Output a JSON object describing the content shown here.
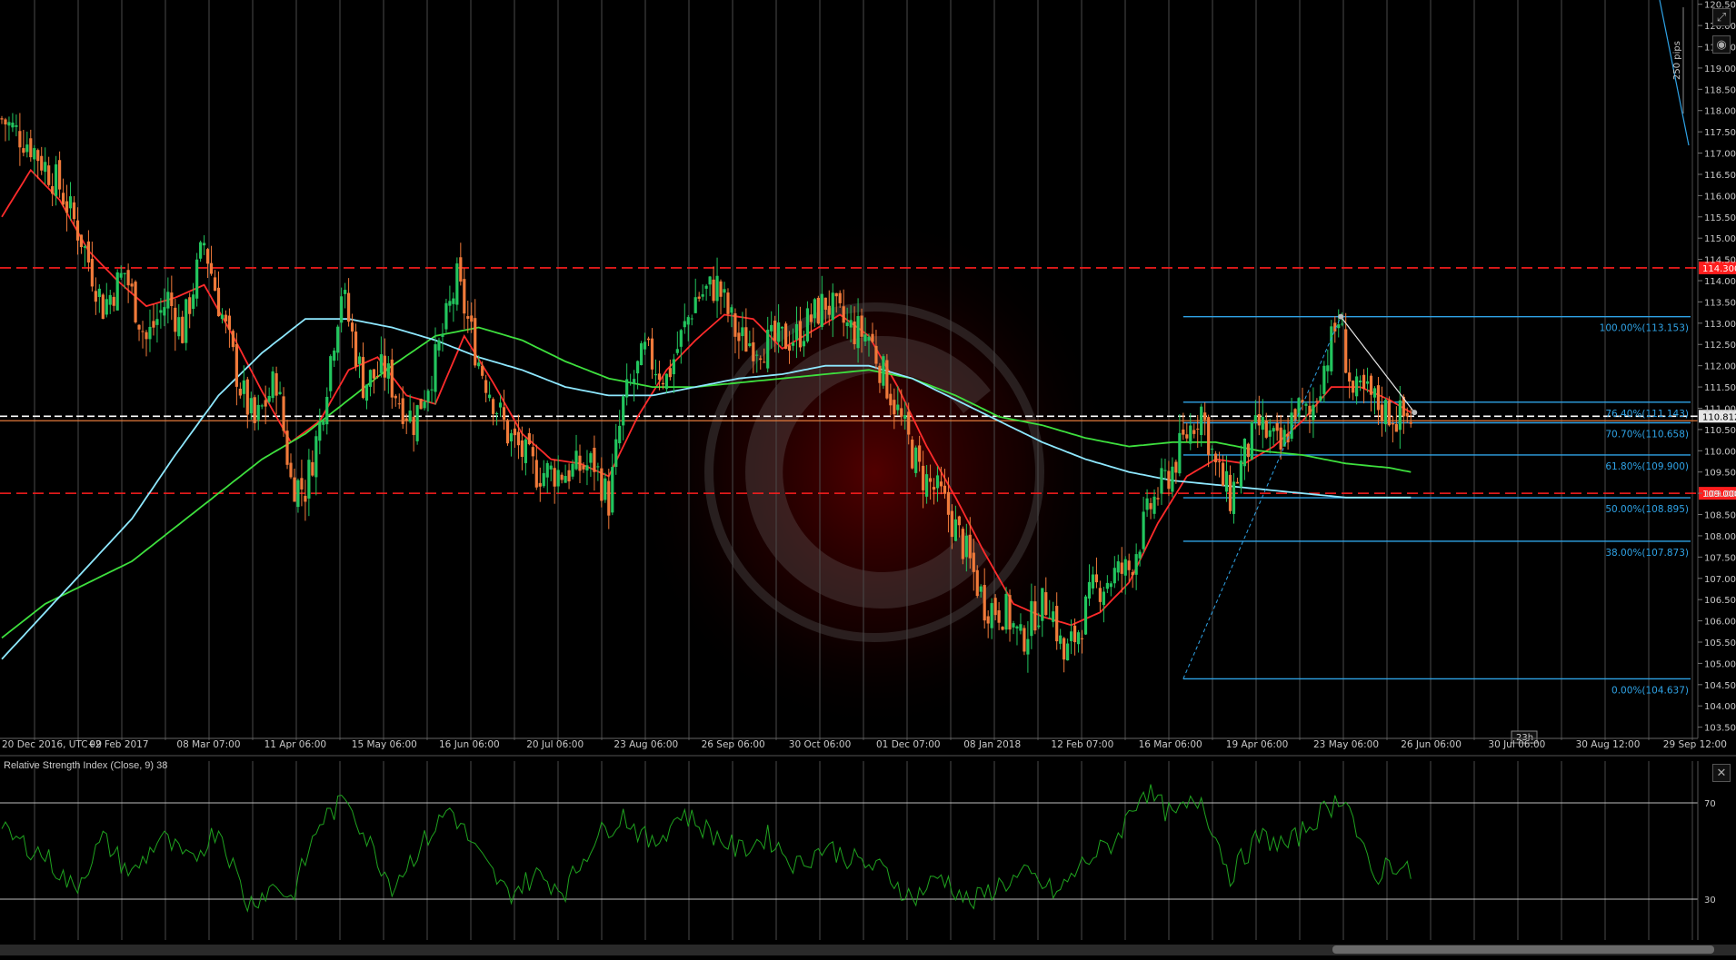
{
  "colors": {
    "background": "#000000",
    "grid": "#4a4a4a",
    "bull": "#22c55e",
    "bear": "#f07a3a",
    "ema_fast": "#ff2b2b",
    "ema_mid": "#3ee03e",
    "ema_slow": "#8ee8ff",
    "fib": "#2fa3e6",
    "resistance": "#ff1e1e",
    "rsi_line": "#1fa31f",
    "price_tag_bg": "#e6e6e6"
  },
  "icons": {
    "top_right_1": "maximize-icon",
    "top_right_2": "camera-icon",
    "rsi_close": "close-icon",
    "timer": "timer-badge"
  },
  "rsi": {
    "title": "Relative Strength Index (Close, 9) 38",
    "levels": [
      "70",
      "30"
    ]
  },
  "timer_label": "23h",
  "current_price_label": "110.812",
  "chart_data": {
    "type": "candlestick",
    "x_tick_labels": [
      "20 Dec 2016, UTC+9",
      "02 Feb 2017",
      "08 Mar 07:00",
      "11 Apr 06:00",
      "15 May 06:00",
      "16 Jun 06:00",
      "20 Jul 06:00",
      "23 Aug 06:00",
      "26 Sep 06:00",
      "30 Oct 06:00",
      "01 Dec 07:00",
      "08 Jan 2018",
      "12 Feb 07:00",
      "16 Mar 06:00",
      "19 Apr 06:00",
      "23 May 06:00",
      "26 Jun 06:00",
      "30 Jul 06:00",
      "30 Aug 12:00",
      "29 Sep 12:00"
    ],
    "y_ticks": [
      "103.500",
      "104.000",
      "104.500",
      "105.000",
      "105.500",
      "106.000",
      "106.500",
      "107.000",
      "107.500",
      "108.000",
      "108.500",
      "109.000",
      "109.500",
      "110.000",
      "110.500",
      "111.000",
      "111.500",
      "112.000",
      "112.500",
      "113.000",
      "113.500",
      "114.000",
      "114.500",
      "115.000",
      "115.500",
      "116.000",
      "116.500",
      "117.000",
      "117.500",
      "118.000",
      "118.500",
      "119.000",
      "119.500",
      "120.000",
      "120.500"
    ],
    "ylim": [
      103.3,
      120.6
    ],
    "grid": true,
    "horizontal_levels": [
      {
        "label": "114.300",
        "value": 114.3,
        "style": "dashed"
      },
      {
        "label": "109.000",
        "value": 109.0,
        "style": "dashed"
      }
    ],
    "current_price": 110.812,
    "fibonacci": [
      {
        "label": "100.00%(113.153)",
        "value": 113.153
      },
      {
        "label": "76.40%(111.143)",
        "value": 111.143
      },
      {
        "label": "70.70%(110.658)",
        "value": 110.658
      },
      {
        "label": "61.80%(109.900)",
        "value": 109.9
      },
      {
        "label": "50.00%(108.895)",
        "value": 108.895
      },
      {
        "label": "38.00%(107.873)",
        "value": 107.873
      },
      {
        "label": "0.00%(104.637)",
        "value": 104.637
      }
    ],
    "trend_annotation": "250 pips",
    "close_path": [
      [
        0,
        117.8
      ],
      [
        4,
        117.2
      ],
      [
        8,
        116.2
      ],
      [
        11,
        115.0
      ],
      [
        14,
        113.4
      ],
      [
        17,
        114.2
      ],
      [
        20,
        112.6
      ],
      [
        23,
        113.6
      ],
      [
        25,
        112.8
      ],
      [
        28,
        114.9
      ],
      [
        30,
        113.5
      ],
      [
        33,
        111.5
      ],
      [
        35,
        110.6
      ],
      [
        38,
        111.7
      ],
      [
        40,
        109.3
      ],
      [
        42,
        109.1
      ],
      [
        44,
        110.6
      ],
      [
        47,
        113.8
      ],
      [
        50,
        111.6
      ],
      [
        53,
        111.9
      ],
      [
        55,
        111.2
      ],
      [
        57,
        110.7
      ],
      [
        60,
        112.1
      ],
      [
        63,
        114.0
      ],
      [
        66,
        112.1
      ],
      [
        70,
        110.4
      ],
      [
        74,
        109.5
      ],
      [
        78,
        109.5
      ],
      [
        82,
        109.7
      ],
      [
        84,
        108.8
      ],
      [
        86,
        111.1
      ],
      [
        89,
        112.3
      ],
      [
        92,
        111.7
      ],
      [
        96,
        113.6
      ],
      [
        99,
        113.9
      ],
      [
        102,
        112.6
      ],
      [
        106,
        112.5
      ],
      [
        110,
        112.7
      ],
      [
        114,
        113.5
      ],
      [
        117,
        112.9
      ],
      [
        120,
        112.7
      ],
      [
        124,
        110.9
      ],
      [
        127,
        109.5
      ],
      [
        130,
        108.9
      ],
      [
        133,
        107.8
      ],
      [
        136,
        106.4
      ],
      [
        139,
        106.2
      ],
      [
        141,
        105.5
      ],
      [
        143,
        106.2
      ],
      [
        145,
        106.5
      ],
      [
        147,
        105.1
      ],
      [
        149,
        105.8
      ],
      [
        151,
        106.7
      ],
      [
        154,
        107.1
      ],
      [
        156,
        107.2
      ],
      [
        159,
        108.7
      ],
      [
        162,
        109.6
      ],
      [
        164,
        110.4
      ],
      [
        166,
        111.0
      ],
      [
        168,
        109.6
      ],
      [
        170,
        108.9
      ],
      [
        172,
        109.9
      ],
      [
        174,
        110.6
      ],
      [
        177,
        110.0
      ],
      [
        179,
        111.0
      ],
      [
        181,
        110.8
      ],
      [
        183,
        112.0
      ],
      [
        185,
        113.1
      ],
      [
        187,
        111.3
      ],
      [
        189,
        111.3
      ],
      [
        191,
        111.0
      ],
      [
        193,
        110.8
      ],
      [
        195,
        110.8
      ]
    ],
    "series": [
      {
        "kind": "ema_fast",
        "values": [
          [
            0,
            115.5
          ],
          [
            4,
            116.6
          ],
          [
            8,
            115.9
          ],
          [
            12,
            114.7
          ],
          [
            16,
            114.0
          ],
          [
            20,
            113.4
          ],
          [
            24,
            113.6
          ],
          [
            28,
            113.9
          ],
          [
            32,
            112.7
          ],
          [
            36,
            111.4
          ],
          [
            40,
            110.2
          ],
          [
            44,
            110.7
          ],
          [
            48,
            111.9
          ],
          [
            52,
            112.2
          ],
          [
            56,
            111.3
          ],
          [
            60,
            111.1
          ],
          [
            64,
            112.7
          ],
          [
            68,
            111.6
          ],
          [
            72,
            110.4
          ],
          [
            76,
            109.8
          ],
          [
            80,
            109.7
          ],
          [
            84,
            109.4
          ],
          [
            88,
            110.8
          ],
          [
            92,
            111.9
          ],
          [
            96,
            112.6
          ],
          [
            100,
            113.2
          ],
          [
            104,
            113.1
          ],
          [
            108,
            112.4
          ],
          [
            112,
            112.8
          ],
          [
            116,
            113.2
          ],
          [
            120,
            112.7
          ],
          [
            124,
            111.5
          ],
          [
            128,
            110.1
          ],
          [
            132,
            108.9
          ],
          [
            136,
            107.6
          ],
          [
            140,
            106.4
          ],
          [
            144,
            106.1
          ],
          [
            148,
            105.9
          ],
          [
            152,
            106.2
          ],
          [
            156,
            106.9
          ],
          [
            160,
            108.3
          ],
          [
            164,
            109.4
          ],
          [
            168,
            109.8
          ],
          [
            172,
            109.7
          ],
          [
            176,
            110.1
          ],
          [
            180,
            110.7
          ],
          [
            184,
            111.5
          ],
          [
            188,
            111.5
          ],
          [
            192,
            111.2
          ],
          [
            195,
            110.9
          ]
        ]
      },
      {
        "kind": "ema_mid",
        "values": [
          [
            0,
            105.6
          ],
          [
            6,
            106.4
          ],
          [
            12,
            106.9
          ],
          [
            18,
            107.4
          ],
          [
            24,
            108.2
          ],
          [
            30,
            109.0
          ],
          [
            36,
            109.8
          ],
          [
            42,
            110.4
          ],
          [
            48,
            111.2
          ],
          [
            54,
            112.0
          ],
          [
            60,
            112.7
          ],
          [
            66,
            112.9
          ],
          [
            72,
            112.6
          ],
          [
            78,
            112.1
          ],
          [
            84,
            111.7
          ],
          [
            90,
            111.5
          ],
          [
            96,
            111.5
          ],
          [
            102,
            111.6
          ],
          [
            108,
            111.7
          ],
          [
            114,
            111.8
          ],
          [
            120,
            111.9
          ],
          [
            126,
            111.7
          ],
          [
            132,
            111.3
          ],
          [
            138,
            110.8
          ],
          [
            144,
            110.6
          ],
          [
            150,
            110.3
          ],
          [
            156,
            110.1
          ],
          [
            162,
            110.2
          ],
          [
            168,
            110.2
          ],
          [
            174,
            110.0
          ],
          [
            180,
            109.9
          ],
          [
            186,
            109.7
          ],
          [
            192,
            109.6
          ],
          [
            195,
            109.5
          ]
        ]
      },
      {
        "kind": "ema_slow",
        "values": [
          [
            0,
            105.1
          ],
          [
            6,
            106.2
          ],
          [
            12,
            107.3
          ],
          [
            18,
            108.4
          ],
          [
            24,
            109.9
          ],
          [
            30,
            111.3
          ],
          [
            36,
            112.3
          ],
          [
            42,
            113.1
          ],
          [
            48,
            113.1
          ],
          [
            54,
            112.9
          ],
          [
            60,
            112.6
          ],
          [
            66,
            112.2
          ],
          [
            72,
            111.9
          ],
          [
            78,
            111.5
          ],
          [
            84,
            111.3
          ],
          [
            90,
            111.3
          ],
          [
            96,
            111.5
          ],
          [
            102,
            111.7
          ],
          [
            108,
            111.8
          ],
          [
            114,
            112.0
          ],
          [
            120,
            112.0
          ],
          [
            126,
            111.7
          ],
          [
            132,
            111.2
          ],
          [
            138,
            110.7
          ],
          [
            144,
            110.2
          ],
          [
            150,
            109.8
          ],
          [
            156,
            109.5
          ],
          [
            162,
            109.3
          ],
          [
            168,
            109.2
          ],
          [
            174,
            109.1
          ],
          [
            180,
            109.0
          ],
          [
            186,
            108.9
          ],
          [
            192,
            108.9
          ],
          [
            195,
            108.9
          ]
        ]
      }
    ],
    "rsi_path": [
      [
        0,
        58
      ],
      [
        6,
        48
      ],
      [
        10,
        34
      ],
      [
        14,
        55
      ],
      [
        18,
        40
      ],
      [
        22,
        56
      ],
      [
        26,
        45
      ],
      [
        30,
        60
      ],
      [
        34,
        28
      ],
      [
        38,
        36
      ],
      [
        40,
        30
      ],
      [
        44,
        62
      ],
      [
        48,
        72
      ],
      [
        50,
        58
      ],
      [
        54,
        36
      ],
      [
        58,
        52
      ],
      [
        62,
        68
      ],
      [
        66,
        48
      ],
      [
        70,
        32
      ],
      [
        74,
        40
      ],
      [
        78,
        34
      ],
      [
        82,
        55
      ],
      [
        86,
        65
      ],
      [
        90,
        52
      ],
      [
        94,
        66
      ],
      [
        98,
        58
      ],
      [
        102,
        50
      ],
      [
        106,
        56
      ],
      [
        110,
        44
      ],
      [
        114,
        52
      ],
      [
        118,
        46
      ],
      [
        122,
        42
      ],
      [
        126,
        30
      ],
      [
        130,
        40
      ],
      [
        134,
        28
      ],
      [
        138,
        36
      ],
      [
        142,
        40
      ],
      [
        146,
        32
      ],
      [
        150,
        46
      ],
      [
        154,
        54
      ],
      [
        158,
        76
      ],
      [
        162,
        64
      ],
      [
        166,
        72
      ],
      [
        170,
        40
      ],
      [
        174,
        56
      ],
      [
        178,
        52
      ],
      [
        182,
        64
      ],
      [
        186,
        74
      ],
      [
        188,
        52
      ],
      [
        190,
        38
      ],
      [
        192,
        46
      ],
      [
        195,
        40
      ]
    ]
  }
}
